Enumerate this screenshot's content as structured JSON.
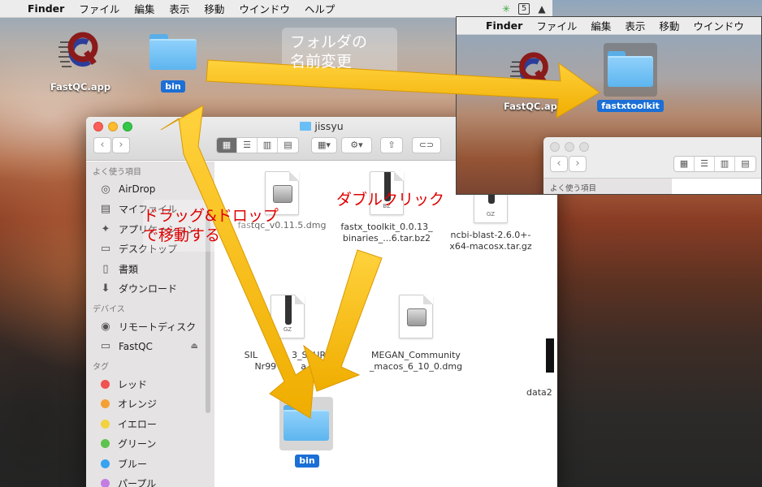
{
  "menubar": {
    "items": [
      "Finder",
      "ファイル",
      "編集",
      "表示",
      "移動",
      "ウインドウ",
      "ヘルプ"
    ]
  },
  "desktop": {
    "fastqc_label": "FastQC.app",
    "bin_label": "bin"
  },
  "window": {
    "title": "jissyu",
    "sidebar": {
      "favorites_header": "よく使う項目",
      "favorites": [
        "AirDrop",
        "マイファイル",
        "アプリケーション",
        "デスクトップ",
        "書類",
        "ダウンロード"
      ],
      "devices_header": "デバイス",
      "devices": [
        "リモートディスク",
        "FastQC"
      ],
      "tags_header": "タグ",
      "tags": [
        {
          "label": "レッド",
          "color": "#f0524f"
        },
        {
          "label": "オレンジ",
          "color": "#f5a032"
        },
        {
          "label": "イエロー",
          "color": "#f3d23f"
        },
        {
          "label": "グリーン",
          "color": "#5ec34e"
        },
        {
          "label": "ブルー",
          "color": "#39a3ef"
        },
        {
          "label": "パープル",
          "color": "#c37de2"
        }
      ]
    },
    "files": {
      "fastqc_dmg": "fastqc_v0.11.5.dmg",
      "fastx_line1": "fastx_toolkit_0.0.13_",
      "fastx_line2": "binaries_...6.tar.bz2",
      "ncbi_line1": "ncbi-blast-2.6.0+-",
      "ncbi_line2": "x64-macosx.tar.gz",
      "silva_line1": "SIL",
      "silva_line1b": "3_SSURe",
      "silva_line2": "Nr99",
      "silva_line2b": "a.fa.",
      "megan_line1": "MEGAN_Community",
      "megan_line2": "_macos_6_10_0.dmg",
      "data_label": "data2",
      "bin_label": "bin",
      "bz_ext": "BZ",
      "gz_ext": "GZ"
    }
  },
  "inset": {
    "menubar": [
      "Finder",
      "ファイル",
      "編集",
      "表示",
      "移動",
      "ウインドウ"
    ],
    "fastqc_label": "FastQC.app",
    "folder_label": "fastxtoolkit",
    "sidebar_header": "よく使う項目"
  },
  "annotations": {
    "rename_line1": "フォルダの",
    "rename_line2": "名前変更",
    "doubleclick": "ダブルクリック",
    "drag_line1": "ドラッグ&ドロップ",
    "drag_line2": "で移動する",
    "arrow_color": "#f5bc16"
  }
}
